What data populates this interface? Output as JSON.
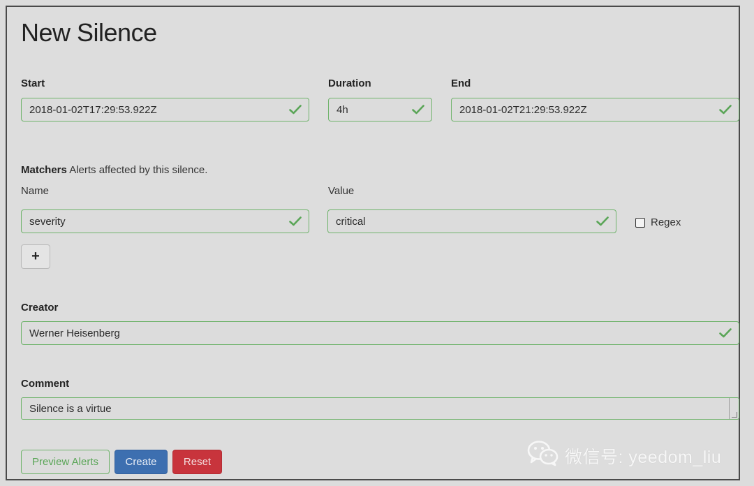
{
  "page": {
    "title": "New Silence"
  },
  "start": {
    "label": "Start",
    "value": "2018-01-02T17:29:53.922Z"
  },
  "duration": {
    "label": "Duration",
    "value": "4h"
  },
  "end": {
    "label": "End",
    "value": "2018-01-02T21:29:53.922Z"
  },
  "matchers": {
    "label": "Matchers",
    "description": "Alerts affected by this silence.",
    "name_label": "Name",
    "value_label": "Value",
    "rows": [
      {
        "name": "severity",
        "value": "critical",
        "regex_label": "Regex",
        "regex_checked": false
      }
    ],
    "add_label": "+"
  },
  "creator": {
    "label": "Creator",
    "value": "Werner Heisenberg"
  },
  "comment": {
    "label": "Comment",
    "value": "Silence is a virtue"
  },
  "actions": {
    "preview_label": "Preview Alerts",
    "create_label": "Create",
    "reset_label": "Reset"
  },
  "watermark": {
    "text": "微信号: yeedom_liu"
  },
  "colors": {
    "valid": "#5aa557",
    "primary": "#3d6fb0",
    "danger": "#c8343c"
  },
  "icons": {
    "valid": "check-icon",
    "add": "plus-icon",
    "watermark": "wechat-icon"
  }
}
